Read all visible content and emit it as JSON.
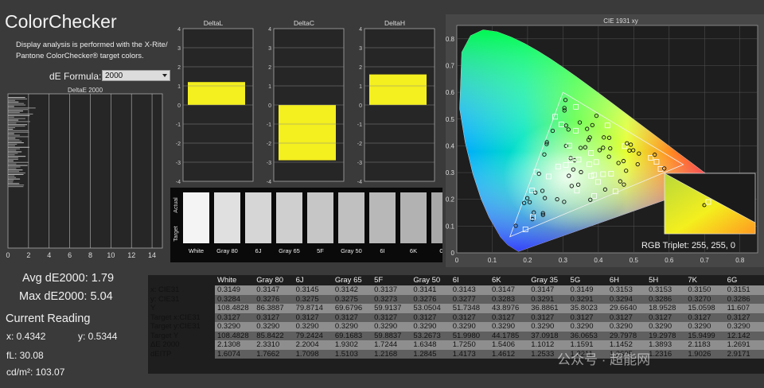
{
  "title": "ColorChecker",
  "description": "Display analysis is performed with the X-Rite/ Pantone ColorChecker® target colors.",
  "formula": {
    "label": "dE Formula:",
    "value": "2000"
  },
  "deltae_chart": {
    "title": "DeltaE 2000",
    "x_ticks": [
      "0",
      "2",
      "4",
      "6",
      "8",
      "10",
      "12",
      "14"
    ]
  },
  "delta_l": {
    "title": "DeltaL",
    "y_ticks": [
      "4",
      "3",
      "2",
      "1",
      "0",
      "-1",
      "-2",
      "-3",
      "-4"
    ],
    "value": 1.2,
    "color": "#f4ef1e"
  },
  "delta_c": {
    "title": "DeltaC",
    "y_ticks": [
      "4",
      "3",
      "2",
      "1",
      "0",
      "-1",
      "-2",
      "-3",
      "-4"
    ],
    "value": -2.9,
    "color": "#f4ef1e"
  },
  "delta_h": {
    "title": "DeltaH",
    "y_ticks": [
      "4",
      "3",
      "2",
      "1",
      "0",
      "-1",
      "-2",
      "-3",
      "-4"
    ],
    "value": 1.6,
    "color": "#f4ef1e"
  },
  "swatches": {
    "side_labels": [
      "Actual",
      "Target"
    ],
    "items": [
      "White",
      "Gray 80",
      "6J",
      "Gray 65",
      "5F",
      "Gray 50",
      "6I",
      "6K",
      "Gra"
    ],
    "colors": [
      "#f4f4f4",
      "#e0e0e0",
      "#d6d6d6",
      "#cfcfcf",
      "#c6c6c6",
      "#c0c0c0",
      "#b8b8b8",
      "#b2b2b2",
      "#a8a8a8"
    ]
  },
  "cie": {
    "title": "CIE 1931 xy",
    "x_ticks": [
      "0",
      "0.1",
      "0.2",
      "0.3",
      "0.4",
      "0.5",
      "0.6",
      "0.7",
      "0.8"
    ],
    "y_ticks": [
      "0.8",
      "0.7",
      "0.6",
      "0.5",
      "0.4",
      "0.3",
      "0.2",
      "0.1",
      "0"
    ],
    "rgb_triplet": "RGB Triplet: 255, 255, 0"
  },
  "stats": {
    "avg": "Avg dE2000: 1.79",
    "max": "Max dE2000: 5.04",
    "current": "Current Reading",
    "x": "x: 0.4342",
    "y": "y: 0.5344",
    "fl": "fL: 30.08",
    "cd": "cd/m²: 103.07"
  },
  "table": {
    "headers": [
      "",
      "White",
      "Gray 80",
      "6J",
      "Gray 65",
      "5F",
      "Gray 50",
      "6I",
      "6K",
      "Gray 35",
      "5G",
      "6H",
      "5H",
      "7K",
      "6G"
    ],
    "rows": [
      [
        "x: CIE31",
        "0.3149",
        "0.3147",
        "0.3145",
        "0.3142",
        "0.3137",
        "0.3141",
        "0.3143",
        "0.3147",
        "0.3147",
        "0.3149",
        "0.3153",
        "0.3153",
        "0.3150",
        "0.3151"
      ],
      [
        "y: CIE31",
        "0.3284",
        "0.3276",
        "0.3275",
        "0.3275",
        "0.3273",
        "0.3276",
        "0.3277",
        "0.3283",
        "0.3291",
        "0.3291",
        "0.3294",
        "0.3286",
        "0.3270",
        "0.3286"
      ],
      [
        "Y",
        "108.4828",
        "86.3887",
        "79.8714",
        "69.6796",
        "59.9137",
        "53.0504",
        "51.7348",
        "43.8976",
        "36.8861",
        "35.8023",
        "29.6640",
        "18.9528",
        "15.0598",
        "11.607"
      ],
      [
        "Target x:CIE31",
        "0.3127",
        "0.3127",
        "0.3127",
        "0.3127",
        "0.3127",
        "0.3127",
        "0.3127",
        "0.3127",
        "0.3127",
        "0.3127",
        "0.3127",
        "0.3127",
        "0.3127",
        "0.3127"
      ],
      [
        "Target y:CIE31",
        "0.3290",
        "0.3290",
        "0.3290",
        "0.3290",
        "0.3290",
        "0.3290",
        "0.3290",
        "0.3290",
        "0.3290",
        "0.3290",
        "0.3290",
        "0.3290",
        "0.3290",
        "0.3290"
      ],
      [
        "Target Y",
        "108.4828",
        "85.8422",
        "79.2424",
        "69.1683",
        "59.8837",
        "53.2673",
        "51.9980",
        "44.1785",
        "37.0918",
        "36.0653",
        "29.7978",
        "19.2978",
        "15.9499",
        "12.142"
      ],
      [
        "ΔE 2000",
        "2.1308",
        "2.3310",
        "2.2004",
        "1.9302",
        "1.7244",
        "1.6348",
        "1.7250",
        "1.5406",
        "1.1012",
        "1.1591",
        "1.1452",
        "1.3893",
        "2.1183",
        "1.2691"
      ],
      [
        "dEITP",
        "1.6074",
        "1.7662",
        "1.7098",
        "1.5103",
        "1.2168",
        "1.2845",
        "1.4173",
        "1.4612",
        "1.2533",
        "1.2211",
        "1.2625",
        "1.2316",
        "1.9026",
        "2.9171"
      ]
    ]
  },
  "watermark": "公众号 · 超能网"
}
